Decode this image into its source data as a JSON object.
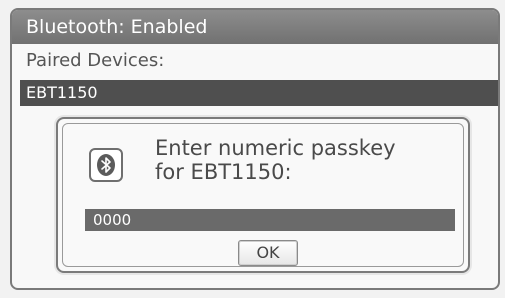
{
  "header": {
    "title": "Bluetooth: Enabled"
  },
  "paired": {
    "label": "Paired Devices:",
    "devices": [
      {
        "name": "EBT1150"
      }
    ]
  },
  "dialog": {
    "icon": "bluetooth-icon",
    "prompt_line1": "Enter numeric passkey",
    "prompt_line2": "for EBT1150:",
    "passkey_value": "0000",
    "ok_label": "OK"
  },
  "colors": {
    "titlebar": "#7f7f7f",
    "selected_row": "#4f4f4f",
    "passkey_field": "#6a6a6a"
  }
}
